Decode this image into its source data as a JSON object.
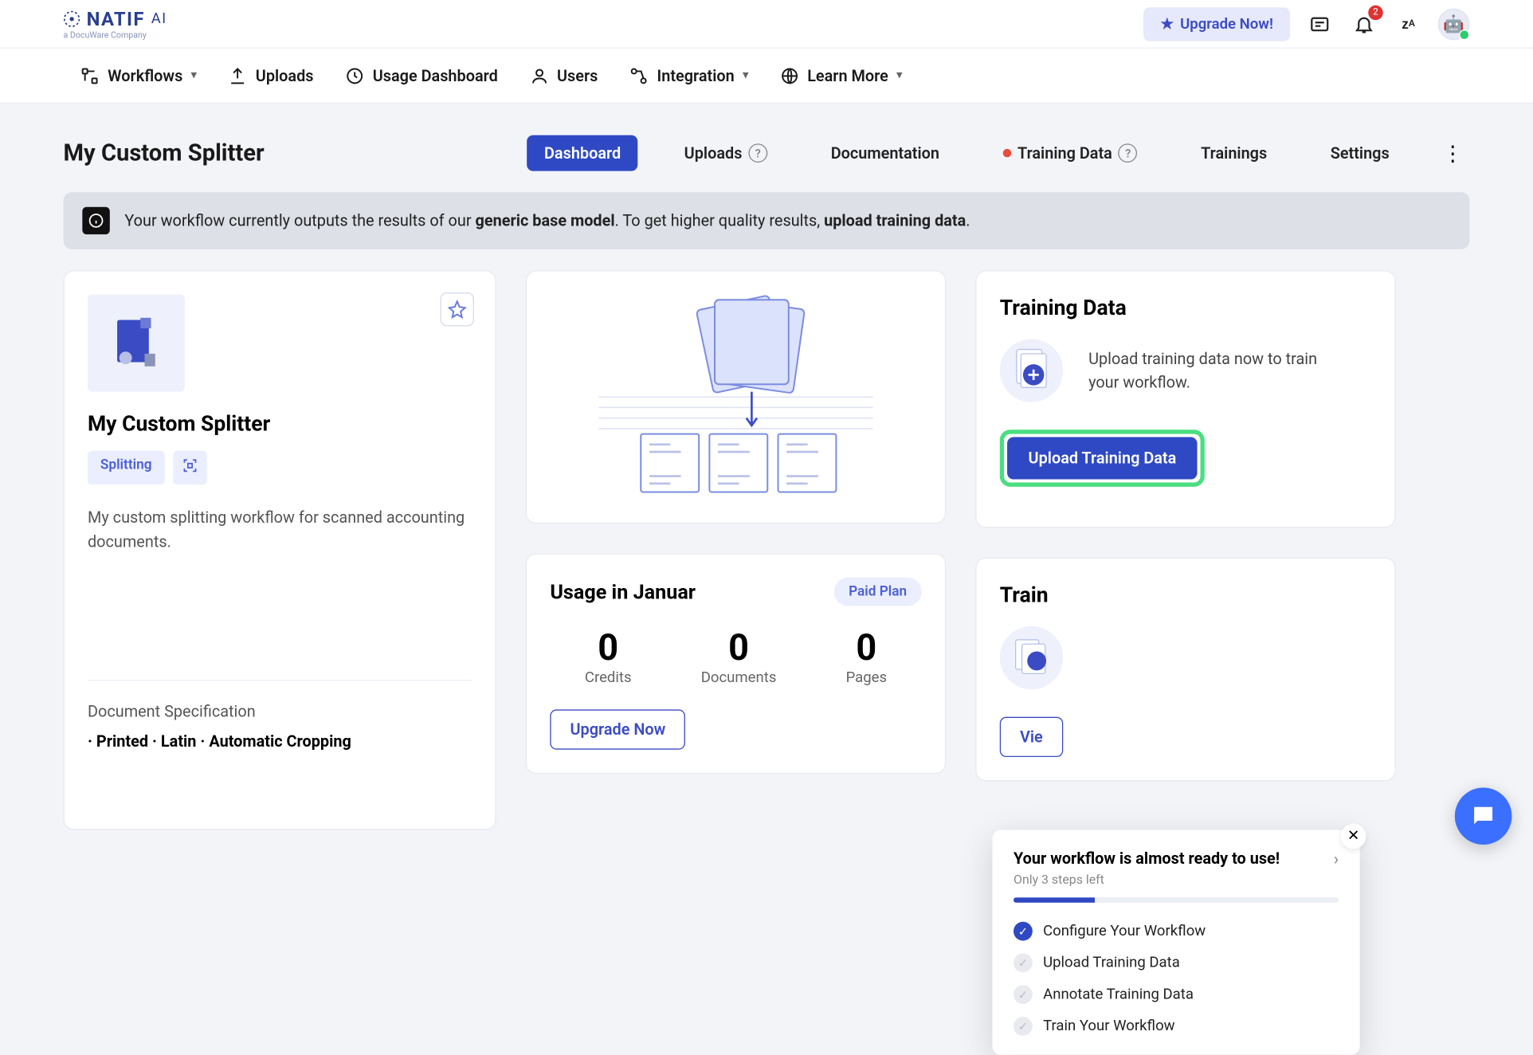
{
  "topbar": {
    "logo_main": "NATIF",
    "logo_suffix": "AI",
    "logo_sub": "a DocuWare Company",
    "upgrade_label": "Upgrade Now!",
    "notif_count": "2"
  },
  "nav": {
    "workflows": "Workflows",
    "uploads": "Uploads",
    "usage_dashboard": "Usage Dashboard",
    "users": "Users",
    "integration": "Integration",
    "learn_more": "Learn More"
  },
  "page": {
    "title": "My Custom Splitter",
    "tabs": {
      "dashboard": "Dashboard",
      "uploads": "Uploads",
      "documentation": "Documentation",
      "training_data": "Training Data",
      "trainings": "Trainings",
      "settings": "Settings"
    }
  },
  "banner": {
    "prefix": "Your workflow currently outputs the results of our ",
    "bold1": "generic base model",
    "mid": ". To get higher quality results, ",
    "bold2": "upload training data",
    "suffix": "."
  },
  "project": {
    "name": "My Custom Splitter",
    "chip1": "Splitting",
    "description": "My custom splitting workflow for scanned accounting documents.",
    "spec_header": "Document Specification",
    "spec_line": "· Printed  · Latin  · Automatic Cropping"
  },
  "usage": {
    "title": "Usage in Januar",
    "plan": "Paid Plan",
    "credits_val": "0",
    "credits_lbl": "Credits",
    "docs_val": "0",
    "docs_lbl": "Documents",
    "pages_val": "0",
    "pages_lbl": "Pages",
    "upgrade_btn": "Upgrade Now"
  },
  "training_data_card": {
    "title": "Training Data",
    "text": "Upload training data now to train your workflow.",
    "button": "Upload Training Data"
  },
  "trainings_card": {
    "title": "Train",
    "view_btn": "Vie"
  },
  "popup": {
    "title": "Your workflow is almost ready to use!",
    "sub": "Only 3 steps left",
    "item1": "Configure Your Workflow",
    "item2": "Upload Training Data",
    "item3": "Annotate Training Data",
    "item4": "Train Your Workflow"
  }
}
